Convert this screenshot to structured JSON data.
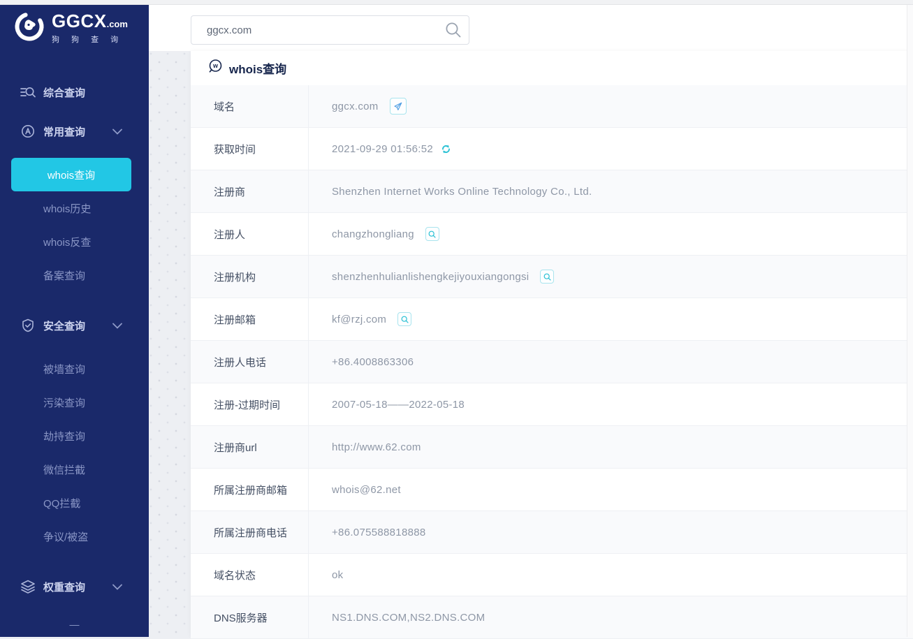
{
  "brand": {
    "logo_text": "GGCX",
    "logo_suffix": ".com",
    "logo_subtitle": "狗 狗 查 询"
  },
  "colors": {
    "sidebar_bg": "#1a296a",
    "active_item_bg": "#22c7e5",
    "icon_teal": "#2bc1d4",
    "send_icon_blue": "#4f9ee3",
    "heading_navy": "#16254c"
  },
  "search": {
    "value": "ggcx.com"
  },
  "sidebar": {
    "items": [
      {
        "label": "综合查询",
        "icon": "search-list-icon"
      },
      {
        "label": "常用查询",
        "icon": "circle-a-icon",
        "expanded": true
      },
      {
        "label": "whois查询",
        "active": true
      },
      {
        "label": "whois历史"
      },
      {
        "label": "whois反查"
      },
      {
        "label": "备案查询"
      },
      {
        "label": "安全查询",
        "icon": "shield-check-icon",
        "expanded": true
      },
      {
        "label": "被墙查询"
      },
      {
        "label": "污染查询"
      },
      {
        "label": "劫持查询"
      },
      {
        "label": "微信拦截"
      },
      {
        "label": "QQ拦截"
      },
      {
        "label": "争议/被盗"
      },
      {
        "label": "权重查询",
        "icon": "layers-icon",
        "expanded": true
      }
    ],
    "overflow_indicator": "—"
  },
  "main": {
    "heading": "whois查询"
  },
  "whois_table": {
    "rows": [
      {
        "label": "域名",
        "value": "ggcx.com",
        "action": "send"
      },
      {
        "label": "获取时间",
        "value": "2021-09-29 01:56:52",
        "action": "refresh"
      },
      {
        "label": "注册商",
        "value": "Shenzhen Internet Works Online Technology Co., Ltd."
      },
      {
        "label": "注册人",
        "value": "changzhongliang",
        "action": "search"
      },
      {
        "label": "注册机构",
        "value": "shenzhenhulianlishengkejiyouxiangongsi",
        "action": "search"
      },
      {
        "label": "注册邮箱",
        "value": "kf@rzj.com",
        "action": "search"
      },
      {
        "label": "注册人电话",
        "value": "+86.4008863306"
      },
      {
        "label": "注册-过期时间",
        "value": "2007-05-18——2022-05-18"
      },
      {
        "label": "注册商url",
        "value": "http://www.62.com"
      },
      {
        "label": "所属注册商邮箱",
        "value": "whois@62.net"
      },
      {
        "label": "所属注册商电话",
        "value": "+86.075588818888"
      },
      {
        "label": "域名状态",
        "value": "ok"
      },
      {
        "label": "DNS服务器",
        "value": "NS1.DNS.COM,NS2.DNS.COM"
      }
    ]
  }
}
